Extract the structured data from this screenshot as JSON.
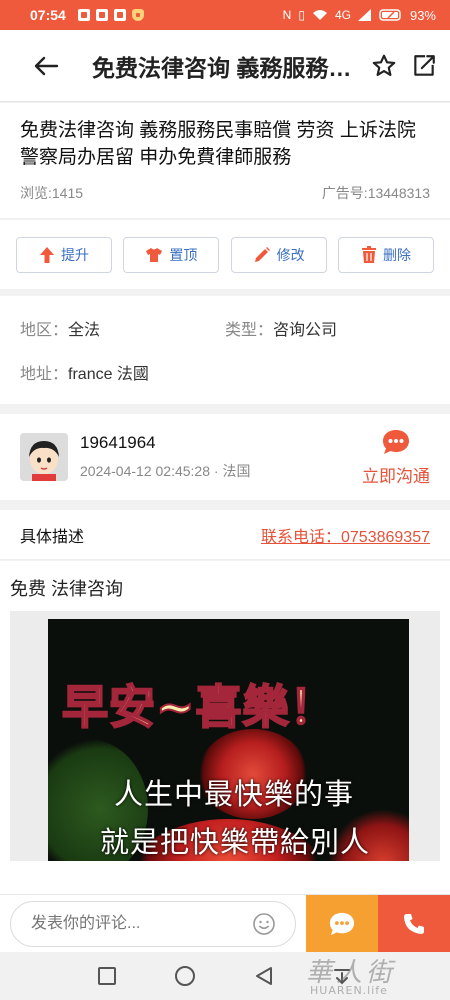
{
  "status_bar": {
    "time": "07:54",
    "battery": "93%",
    "network": "4G"
  },
  "header": {
    "title": "免费法律咨询 義務服務民事賠償 劳资 上诉法院 警察局办居留 申办免費律師服務",
    "back_icon": "arrow-left-icon",
    "favorite_icon": "star-icon",
    "share_icon": "share-icon"
  },
  "post": {
    "title": "免费法律咨询 義務服務民事賠償 劳资 上诉法院 警察局办居留 申办免費律師服務",
    "views": "浏览:1415",
    "ad_no": "广告号:13448313"
  },
  "actions": [
    {
      "label": "提升",
      "icon": "arrow-up-icon"
    },
    {
      "label": "置顶",
      "icon": "shirt-icon"
    },
    {
      "label": "修改",
      "icon": "pencil-icon"
    },
    {
      "label": "删除",
      "icon": "trash-icon"
    }
  ],
  "details": {
    "region_key": "地区：",
    "region_val": "全法",
    "type_key": "类型：",
    "type_val": "咨询公司",
    "address_key": "地址：",
    "address_val": "france 法國"
  },
  "user": {
    "name": "19641964",
    "subline": "2024-04-12 02:45:28 · 法国",
    "chat_label": "立即沟通"
  },
  "description": {
    "label": "具体描述",
    "phone": "联系电话：0753869357",
    "content_text": "免费 法律咨询",
    "image_line_main": "早安~喜樂！",
    "image_line_1": "人生中最快樂的事",
    "image_line_2": "就是把快樂帶給別人"
  },
  "bottom_bar": {
    "comment_placeholder": "发表你的评论...",
    "emoji_icon": "smile-icon",
    "chat_icon": "chat-bubble-icon",
    "call_icon": "phone-icon"
  },
  "watermark": {
    "cn": "華人街",
    "en": "HUAREN.life"
  },
  "colors": {
    "brand": "#f05a3c",
    "accent_orange": "#f5a030",
    "link": "#e5533a",
    "action_blue": "#3a6fc1"
  }
}
